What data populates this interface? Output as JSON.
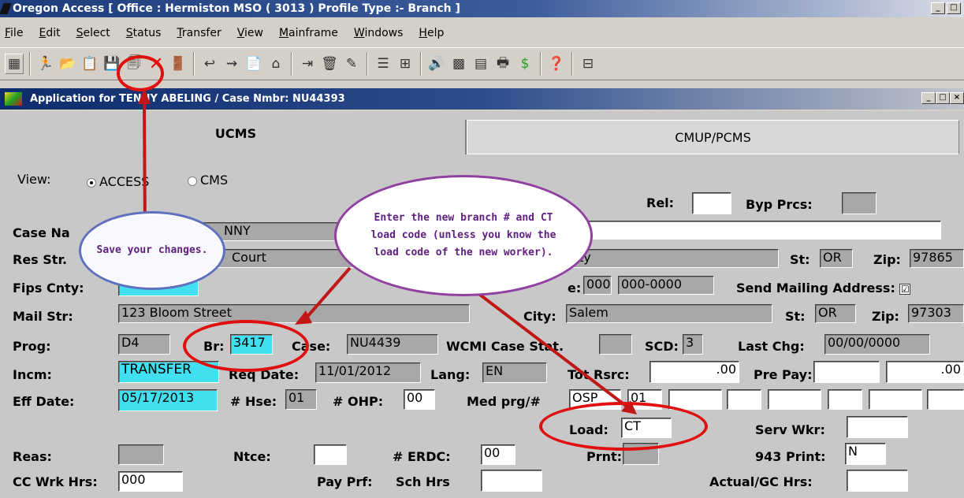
{
  "window": {
    "title": "Oregon Access [ Office : Hermiston MSO ( 3013 ) Profile Type :- Branch ]",
    "minimize": "_",
    "restore": "□",
    "close": "×"
  },
  "menu": [
    "File",
    "Edit",
    "Select",
    "Status",
    "Transfer",
    "View",
    "Mainframe",
    "Windows",
    "Help"
  ],
  "toolbar_icons": [
    "form-icon",
    "runner-icon",
    "folder-open-icon",
    "notes-icon",
    "save-icon",
    "print-icon",
    "delete-icon",
    "exit-door-icon",
    "undo-icon",
    "route-icon",
    "copy-icon",
    "stamp-icon",
    "import-icon",
    "trash-icon",
    "tools-icon",
    "list-icon",
    "tree-icon",
    "sound-icon",
    "grid-icon",
    "report-icon",
    "printer-icon",
    "dollar-icon",
    "help-icon",
    "network-icon"
  ],
  "subwindow": {
    "title": "Application for TENNY ABELING / Case Nmbr: NU44393"
  },
  "tabs": [
    "UCMS",
    "CMUP/PCMS"
  ],
  "form": {
    "view_label": "View:",
    "view_opt1": "ACCESS",
    "view_opt2": "CMS",
    "rel_label": "Rel:",
    "byp_label": "Byp Prcs:",
    "case_name_label": "Case Na",
    "case_name_value": "NNY",
    "res_str_label": "Res Str.",
    "res_str_value": "Court",
    "res_city_value": "ty",
    "st_label": "St:",
    "st_value": "OR",
    "zip_label": "Zip:",
    "zip_value": "97865",
    "fips_label": "Fips Cnty:",
    "phone_label": "e:",
    "phone_area": "000",
    "phone_num": "000-0000",
    "send_mail_label": "Send Mailing Address:",
    "send_mail_check": "☑",
    "mail_str_label": "Mail Str:",
    "mail_str_value": "123 Bloom Street",
    "city_label": "City:",
    "city_value": "Salem",
    "mail_st_label": "St:",
    "mail_st_value": "OR",
    "mail_zip_label": "Zip:",
    "mail_zip_value": "97303",
    "prog_label": "Prog:",
    "prog_value": "D4",
    "br_label": "Br:",
    "br_value": "3417",
    "case_label": "Case:",
    "case_value": "NU4439",
    "wcmi_label": "WCMI Case Stat.",
    "scd_label": "SCD:",
    "scd_value": "3",
    "last_chg_label": "Last Chg:",
    "last_chg_value": "00/00/0000",
    "incm_label": "Incm:",
    "incm_value": "TRANSFER",
    "req_date_label": "Req Date:",
    "req_date_value": "11/01/2012",
    "lang_label": "Lang:",
    "lang_value": "EN",
    "tot_rsrc_label": "Tot Rsrc:",
    "tot_rsrc_value": ".00",
    "pre_pay_label": "Pre Pay:",
    "pre_pay_value": ".00",
    "eff_date_label": "Eff Date:",
    "eff_date_value": "05/17/2013",
    "hse_label": "# Hse:",
    "hse_value": "01",
    "ohp_label": "# OHP:",
    "ohp_value": "00",
    "med_prg_label": "Med prg/#",
    "med_prg_value": "OSP",
    "med_prg_num": "01",
    "load_label": "Load:",
    "load_value": "CT",
    "serv_wkr_label": "Serv Wkr:",
    "reas_label": "Reas:",
    "ntce_label": "Ntce:",
    "erdc_label": "# ERDC:",
    "erdc_value": "00",
    "prnt_label": "Prnt:",
    "print943_label": "943 Print:",
    "print943_value": "N",
    "cc_wrk_label": "CC Wrk Hrs:",
    "cc_wrk_value": "000",
    "pay_prf_label": "Pay Prf:",
    "sch_hrs_label": "Sch Hrs",
    "actual_gc_label": "Actual/GC Hrs:"
  },
  "annotations": {
    "save_callout": "Save your changes.",
    "branch_callout": "Enter the new branch # and CT load code (unless you know the load code of the new worker)."
  }
}
